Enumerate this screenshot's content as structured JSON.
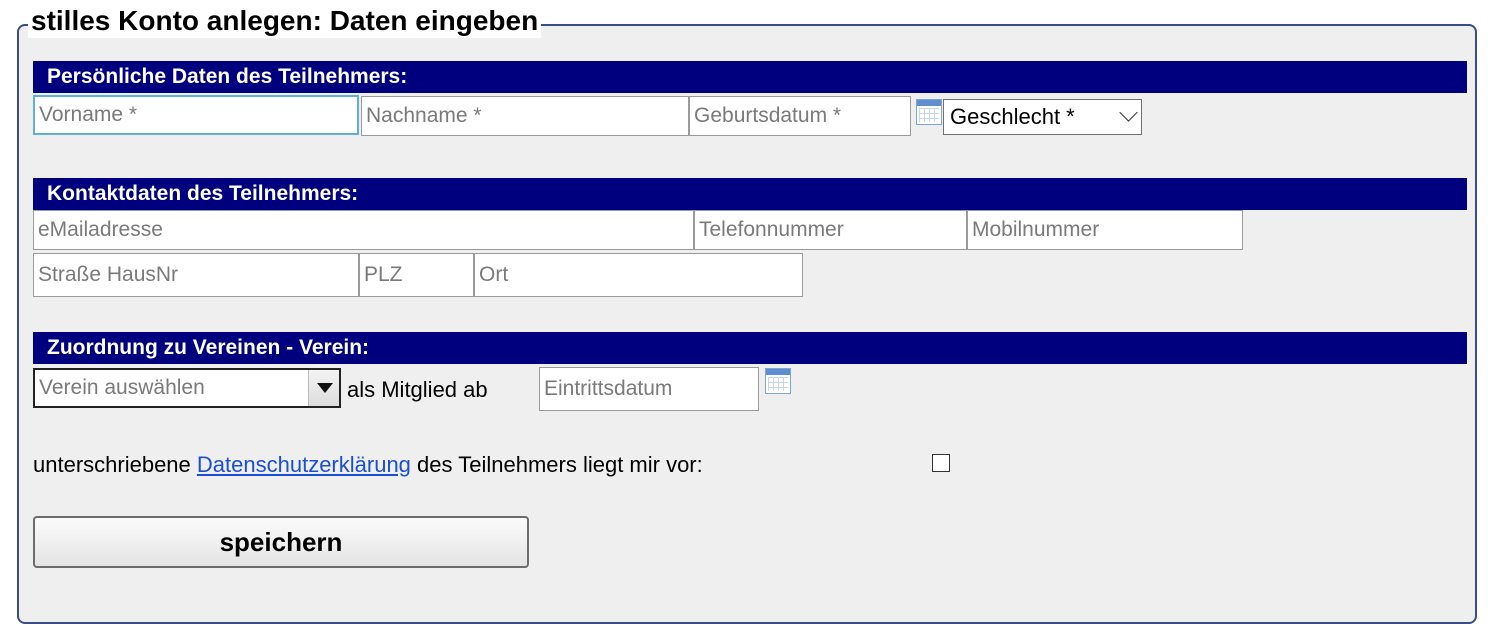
{
  "form_title": "stilles Konto anlegen: Daten eingeben",
  "personal": {
    "header": "Persönliche Daten des Teilnehmers:",
    "vorname_placeholder": "Vorname *",
    "nachname_placeholder": "Nachname *",
    "geburtsdatum_placeholder": "Geburtsdatum *",
    "geschlecht_selected": "Geschlecht *"
  },
  "contact": {
    "header": "Kontaktdaten des Teilnehmers:",
    "email_placeholder": "eMailadresse",
    "telefon_placeholder": "Telefonnummer",
    "mobil_placeholder": "Mobilnummer",
    "strasse_placeholder": "Straße HausNr",
    "plz_placeholder": "PLZ",
    "ort_placeholder": "Ort"
  },
  "club": {
    "header": "Zuordnung zu Vereinen - Verein:",
    "verein_selected": "Verein auswählen",
    "member_since_label": "als Mitglied ab",
    "eintrittsdatum_placeholder": "Eintrittsdatum"
  },
  "privacy": {
    "text_before": "unterschriebene",
    "link_text": "Datenschutzerklärung",
    "text_after": "des Teilnehmers liegt mir vor:"
  },
  "actions": {
    "save_label": "speichern"
  },
  "colors": {
    "header_bg": "#00007f",
    "link": "#1a4fd4",
    "focus_border": "#5fb0d8",
    "panel_bg": "#efefef"
  },
  "icons": {
    "calendar": "calendar-icon",
    "dropdown": "chevron-down-icon"
  }
}
